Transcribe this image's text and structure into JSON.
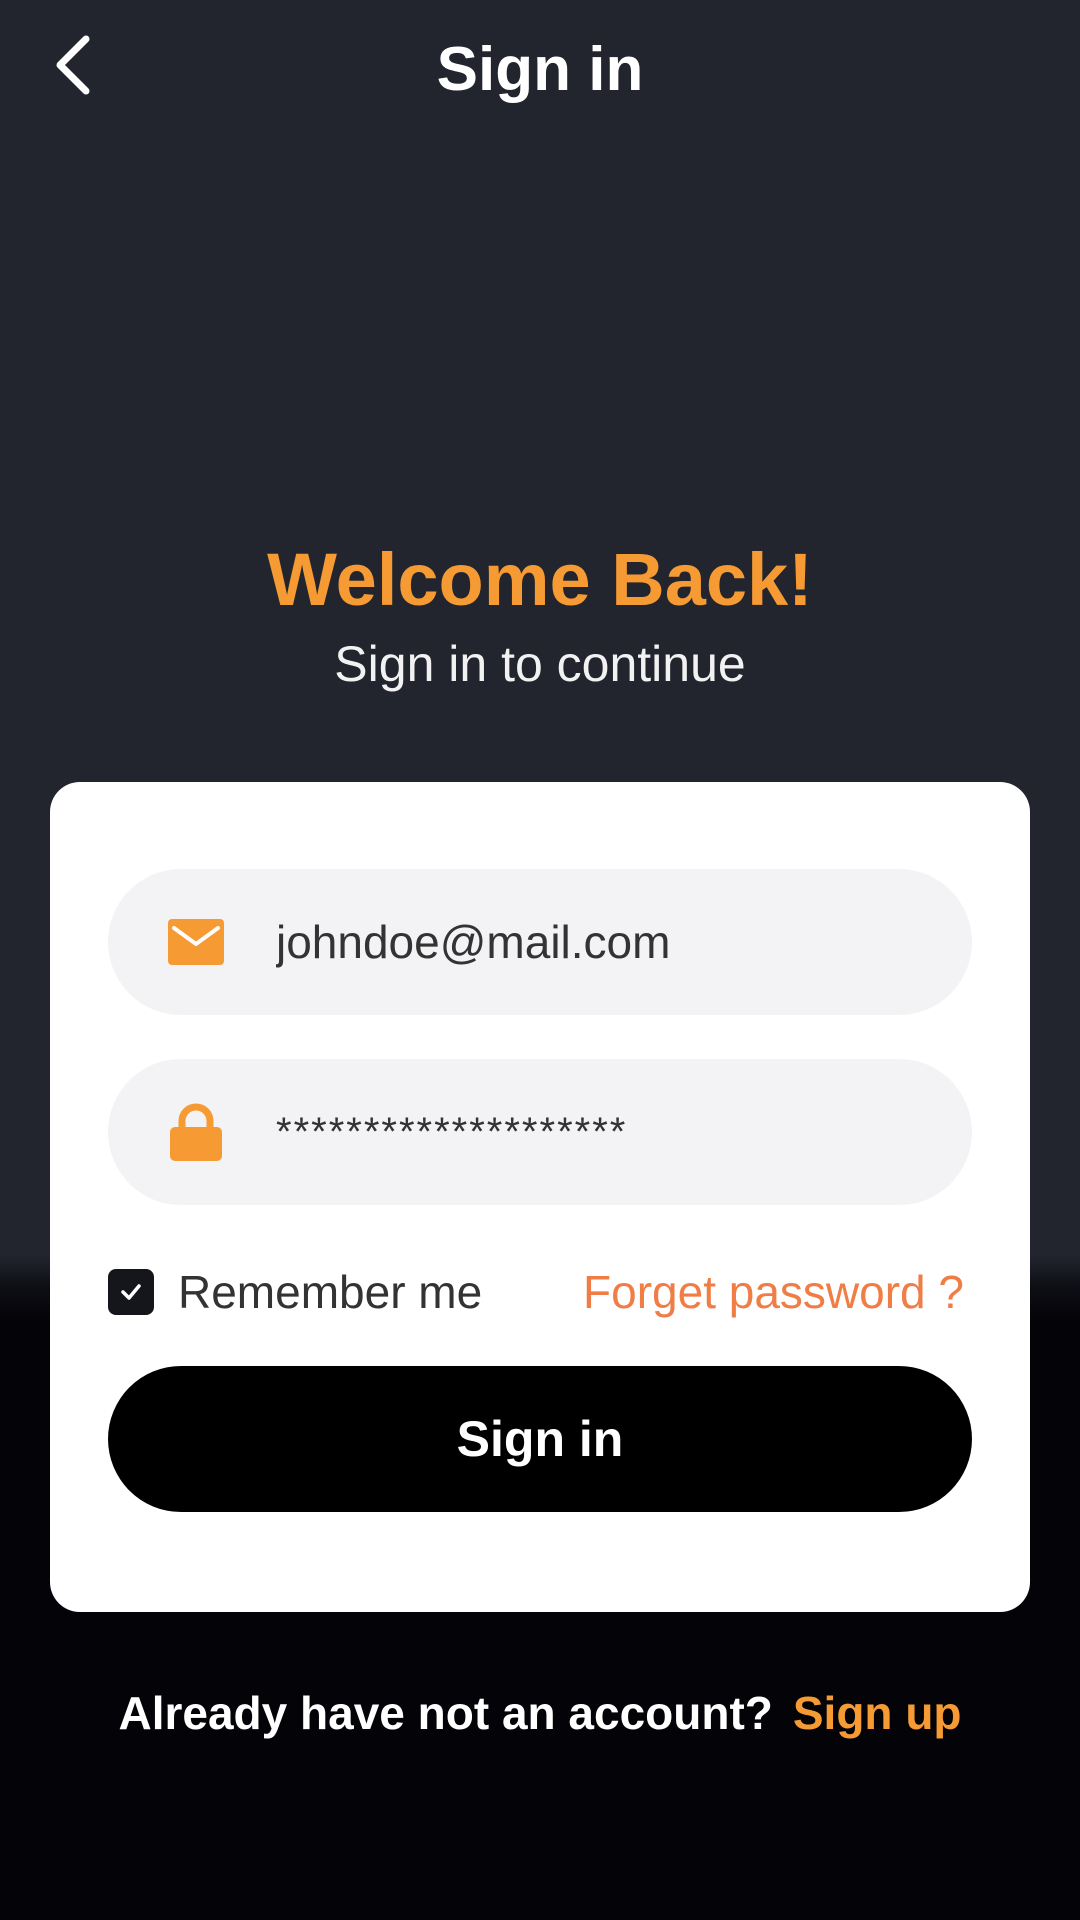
{
  "header": {
    "title": "Sign in",
    "back_icon": "chevron-left-icon"
  },
  "hero": {
    "title": "Welcome Back!",
    "subtitle": "Sign in to continue"
  },
  "form": {
    "email": {
      "icon": "mail-icon",
      "value": "johndoe@mail.com"
    },
    "password": {
      "icon": "lock-icon",
      "value": "********************"
    },
    "remember_me": {
      "label": "Remember me",
      "checked": true
    },
    "forgot_password_label": "Forget password ?",
    "submit_label": "Sign in"
  },
  "footer": {
    "prompt": "Already have not an account?",
    "link_label": "Sign up"
  },
  "colors": {
    "background_top": "#22252e",
    "background_bottom": "#030308",
    "accent_orange": "#f69a33",
    "link_orange": "#f07d45",
    "field_bg": "#f3f3f5",
    "button_bg": "#000000"
  }
}
